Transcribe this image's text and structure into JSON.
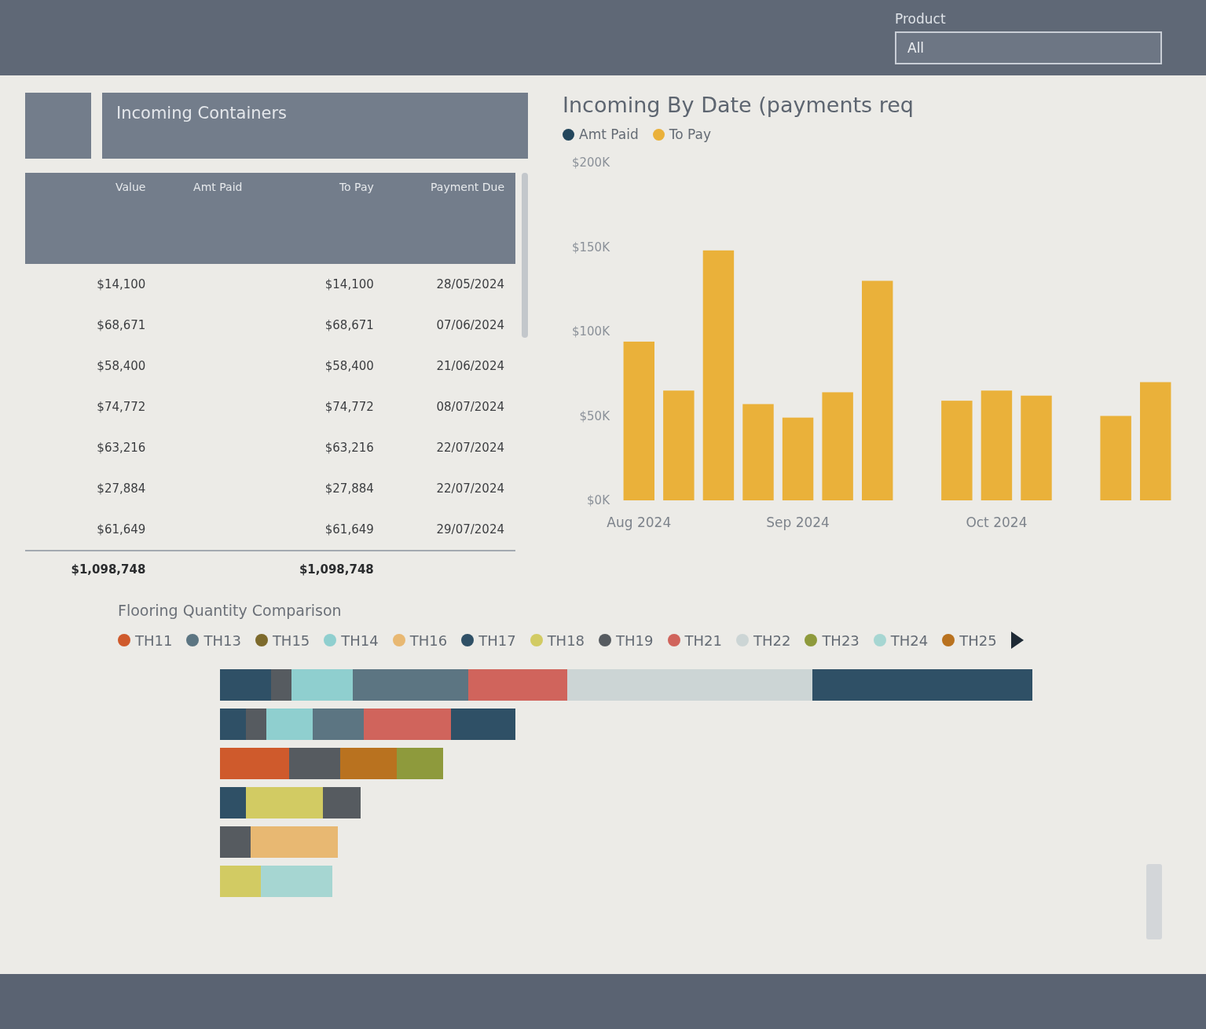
{
  "header": {
    "filter": {
      "label": "Product",
      "value": "All"
    }
  },
  "incoming_containers": {
    "title": "Incoming Containers",
    "columns": [
      "Value",
      "Amt Paid",
      "To Pay",
      "Payment Due"
    ],
    "rows": [
      {
        "value": "$14,100",
        "to_pay": "$14,100",
        "payment_due": "28/05/2024"
      },
      {
        "value": "$68,671",
        "to_pay": "$68,671",
        "payment_due": "07/06/2024"
      },
      {
        "value": "$58,400",
        "to_pay": "$58,400",
        "payment_due": "21/06/2024"
      },
      {
        "value": "$74,772",
        "to_pay": "$74,772",
        "payment_due": "08/07/2024"
      },
      {
        "value": "$63,216",
        "to_pay": "$63,216",
        "payment_due": "22/07/2024"
      },
      {
        "value": "$27,884",
        "to_pay": "$27,884",
        "payment_due": "22/07/2024"
      },
      {
        "value": "$61,649",
        "to_pay": "$61,649",
        "payment_due": "29/07/2024"
      }
    ],
    "totals": {
      "value": "$1,098,748",
      "to_pay": "$1,098,748"
    }
  },
  "incoming_chart": {
    "chart_data": {
      "type": "bar",
      "title": "Incoming By Date (payments req",
      "categories": [
        "Aug 2024",
        null,
        null,
        null,
        "Sep 2024",
        null,
        null,
        null,
        null,
        "Oct 2024",
        null,
        null,
        null,
        null
      ],
      "series": [
        {
          "name": "Amt Paid",
          "color": "#23465c",
          "values": [
            0,
            0,
            0,
            0,
            0,
            0,
            0,
            null,
            0,
            0,
            0,
            null,
            0,
            0
          ]
        },
        {
          "name": "To Pay",
          "color": "#eab13a",
          "values": [
            94000,
            65000,
            148000,
            57000,
            49000,
            64000,
            130000,
            null,
            59000,
            65000,
            62000,
            null,
            50000,
            70000
          ]
        }
      ],
      "ylim": [
        0,
        200000
      ],
      "yticks": [
        {
          "value": 0,
          "label": "$0K"
        },
        {
          "value": 50000,
          "label": "$50K"
        },
        {
          "value": 100000,
          "label": "$100K"
        },
        {
          "value": 150000,
          "label": "$150K"
        },
        {
          "value": 200000,
          "label": "$200K"
        }
      ],
      "stacked": true
    }
  },
  "flooring": {
    "title": "Flooring Quantity Comparison",
    "legend": [
      {
        "label": "TH11",
        "color": "#cf5a2c"
      },
      {
        "label": "TH13",
        "color": "#5c7582"
      },
      {
        "label": "TH15",
        "color": "#7d6a2c"
      },
      {
        "label": "TH14",
        "color": "#8fcfcf"
      },
      {
        "label": "TH16",
        "color": "#e8b872"
      },
      {
        "label": "TH17",
        "color": "#2f5066"
      },
      {
        "label": "TH18",
        "color": "#d2cb63"
      },
      {
        "label": "TH19",
        "color": "#565b60"
      },
      {
        "label": "TH21",
        "color": "#d0645c"
      },
      {
        "label": "TH22",
        "color": "#ccd5d5"
      },
      {
        "label": "TH23",
        "color": "#8e9a3c"
      },
      {
        "label": "TH24",
        "color": "#a6d6d2"
      },
      {
        "label": "TH25",
        "color": "#b9721f"
      }
    ]
  }
}
